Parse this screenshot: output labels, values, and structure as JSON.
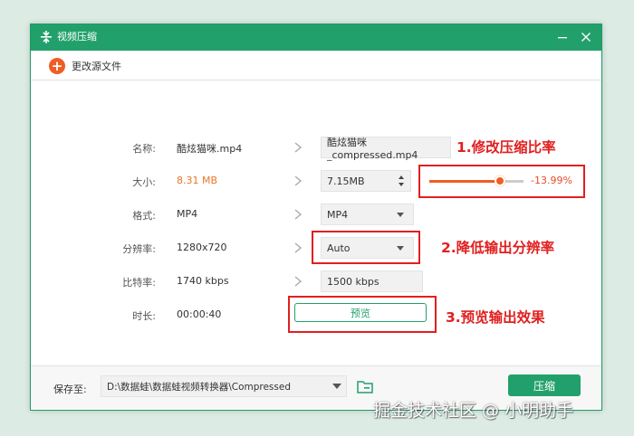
{
  "window": {
    "title": "视频压缩"
  },
  "toolbar": {
    "change_source_label": "更改源文件"
  },
  "rows": {
    "name": {
      "label": "名称:",
      "source": "酷炫猫咪.mp4",
      "output": "酷炫猫咪_compressed.mp4"
    },
    "size": {
      "label": "大小:",
      "source": "8.31 MB",
      "output": "7.15MB",
      "percent": "-13.99%",
      "slider_fraction": 0.75
    },
    "format": {
      "label": "格式:",
      "source": "MP4",
      "output": "MP4"
    },
    "resolution": {
      "label": "分辨率:",
      "source": "1280x720",
      "output": "Auto"
    },
    "bitrate": {
      "label": "比特率:",
      "source": "1740 kbps",
      "output": "1500 kbps"
    },
    "duration": {
      "label": "时长:",
      "source": "00:00:40",
      "preview_label": "预览"
    }
  },
  "annotations": {
    "a1": "1.修改压缩比率",
    "a2": "2.降低输出分辨率",
    "a3": "3.预览输出效果"
  },
  "footer": {
    "save_label": "保存至:",
    "path": "D:\\数据蛙\\数据蛙视频转换器\\Compressed",
    "compress_label": "压缩"
  },
  "watermark": "掘金技术社区 @ 小明助手",
  "colors": {
    "accent": "#22a06b",
    "orange": "#f05d23",
    "annotation_red": "#e02020"
  }
}
